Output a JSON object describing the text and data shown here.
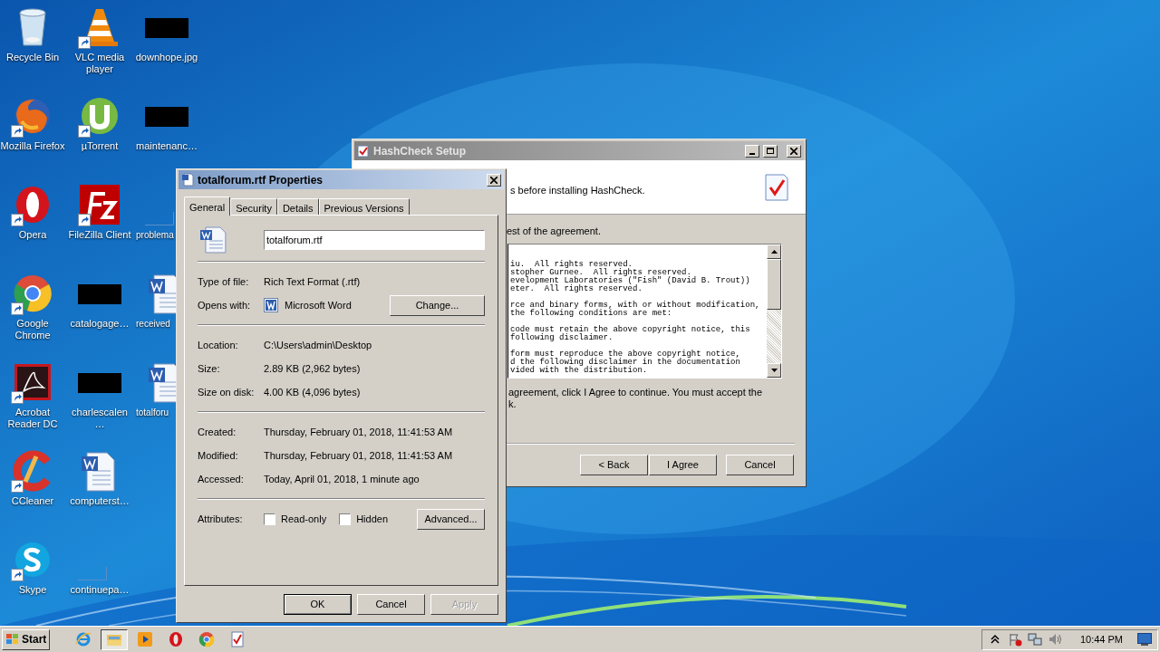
{
  "desktop": {
    "icons": [
      {
        "label": "Recycle Bin",
        "kind": "recycle",
        "shortcut": false,
        "cut_by_window": false
      },
      {
        "label": "Mozilla Firefox",
        "kind": "firefox",
        "shortcut": true,
        "cut_by_window": false
      },
      {
        "label": "Opera",
        "kind": "opera",
        "shortcut": true,
        "cut_by_window": false
      },
      {
        "label": "Google Chrome",
        "kind": "chrome",
        "shortcut": true,
        "cut_by_window": false
      },
      {
        "label": "Acrobat Reader DC",
        "kind": "acrobat",
        "shortcut": true,
        "cut_by_window": false
      },
      {
        "label": "CCleaner",
        "kind": "ccleaner",
        "shortcut": true,
        "cut_by_window": false
      },
      {
        "label": "Skype",
        "kind": "skype",
        "shortcut": true,
        "cut_by_window": false
      },
      {
        "label": "VLC media player",
        "kind": "vlc",
        "shortcut": true,
        "cut_by_window": false
      },
      {
        "label": "µTorrent",
        "kind": "utorrent",
        "shortcut": true,
        "cut_by_window": false
      },
      {
        "label": "FileZilla Client",
        "kind": "filezilla",
        "shortcut": true,
        "cut_by_window": false
      },
      {
        "label": "catalogage…",
        "kind": "thumbnail",
        "shortcut": false,
        "cut_by_window": false
      },
      {
        "label": "charlescalen…",
        "kind": "thumbnail",
        "shortcut": false,
        "cut_by_window": false
      },
      {
        "label": "computerst…",
        "kind": "word",
        "shortcut": false,
        "cut_by_window": false
      },
      {
        "label": "continuepa…",
        "kind": "blank",
        "shortcut": false,
        "cut_by_window": false
      },
      {
        "label": "downhope.jpg",
        "kind": "thumbnail",
        "shortcut": false,
        "cut_by_window": false
      },
      {
        "label": "maintenanc…",
        "kind": "thumbnail",
        "shortcut": false,
        "cut_by_window": false
      },
      {
        "label": "problema",
        "kind": "blank",
        "shortcut": false,
        "cut_by_window": true
      },
      {
        "label": "received",
        "kind": "word",
        "shortcut": false,
        "cut_by_window": true
      },
      {
        "label": "totalforu",
        "kind": "word",
        "shortcut": false,
        "cut_by_window": true
      }
    ]
  },
  "hashcheck_window": {
    "title": "HashCheck Setup",
    "header_text": "s before installing HashCheck.",
    "instruction": "est of the agreement.",
    "license_paragraphs": [
      [
        "iu.  All rights reserved.",
        "stopher Gurnee.  All rights reserved.",
        "evelopment Laboratories (\"Fish\" (David B. Trout))",
        "eter.  All rights reserved."
      ],
      [
        "rce and binary forms, with or without modification,",
        "the following conditions are met:"
      ],
      [
        "code must retain the above copyright notice, this",
        "following disclaimer."
      ],
      [
        "form must reproduce the above copyright notice,",
        "d the following disclaimer in the documentation",
        "vided with the distribution."
      ]
    ],
    "footer_lines": [
      "agreement, click I Agree to continue. You must accept the",
      "k."
    ],
    "buttons": [
      {
        "label": "< Back"
      },
      {
        "label": "I Agree"
      },
      {
        "label": "Cancel"
      }
    ]
  },
  "properties_window": {
    "title": "totalforum.rtf Properties",
    "tabs": [
      {
        "label": "General",
        "selected": true
      },
      {
        "label": "Security",
        "selected": false
      },
      {
        "label": "Details",
        "selected": false
      },
      {
        "label": "Previous Versions",
        "selected": false
      }
    ],
    "file_name": "totalforum.rtf",
    "groups": [
      [
        {
          "label": "Type of file:",
          "value": "Rich Text Format (.rtf)",
          "kind": "text"
        },
        {
          "label": "Opens with:",
          "value": "Microsoft Word",
          "kind": "app",
          "button": "Change..."
        }
      ],
      [
        {
          "label": "Location:",
          "value": "C:\\Users\\admin\\Desktop",
          "kind": "text"
        },
        {
          "label": "Size:",
          "value": "2.89 KB (2,962 bytes)",
          "kind": "text"
        },
        {
          "label": "Size on disk:",
          "value": "4.00 KB (4,096 bytes)",
          "kind": "text"
        }
      ],
      [
        {
          "label": "Created:",
          "value": "Thursday, February 01, 2018, 11:41:53 AM",
          "kind": "text"
        },
        {
          "label": "Modified:",
          "value": "Thursday, February 01, 2018, 11:41:53 AM",
          "kind": "text"
        },
        {
          "label": "Accessed:",
          "value": "Today, April 01, 2018, 1 minute ago",
          "kind": "text"
        }
      ]
    ],
    "attributes": {
      "label": "Attributes:",
      "checkboxes": [
        {
          "label": "Read-only",
          "checked": false
        },
        {
          "label": "Hidden",
          "checked": false
        }
      ],
      "button": "Advanced..."
    },
    "buttons": [
      {
        "label": "OK",
        "default": true,
        "disabled": false
      },
      {
        "label": "Cancel",
        "default": false,
        "disabled": false
      },
      {
        "label": "Apply",
        "default": false,
        "disabled": true
      }
    ]
  },
  "taskbar": {
    "start": "Start",
    "apps": [
      {
        "kind": "ie",
        "selected": false
      },
      {
        "kind": "explorer",
        "selected": true
      },
      {
        "kind": "media",
        "selected": false
      },
      {
        "kind": "opera",
        "selected": false
      },
      {
        "kind": "chrome",
        "selected": false
      },
      {
        "kind": "setup",
        "selected": false
      }
    ],
    "tray": [
      {
        "kind": "chevron"
      },
      {
        "kind": "flag"
      },
      {
        "kind": "network"
      },
      {
        "kind": "volume"
      }
    ],
    "clock": "10:44 PM"
  }
}
